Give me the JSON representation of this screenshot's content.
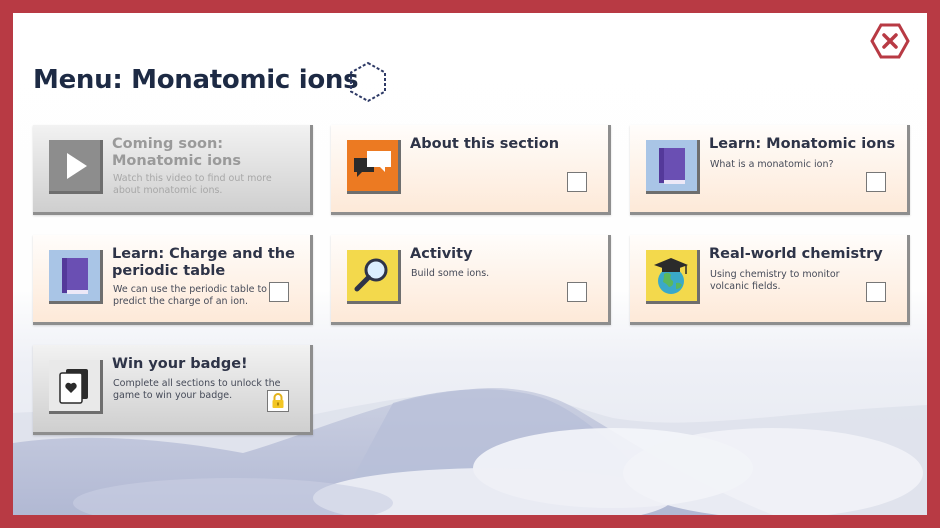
{
  "page": {
    "title": "Menu: Monatomic ions"
  },
  "colors": {
    "frame": "#b83a44",
    "title": "#1d2a44",
    "card_top": "#fffdfb",
    "card_bottom": "#fde9d8",
    "disabled": "#cfcfcf"
  },
  "cards": [
    {
      "title": "Coming soon: Monatomic ions",
      "desc": "Watch this video to find out more about monatomic ions.",
      "icon": "play-icon",
      "state": "disabled"
    },
    {
      "title": "About this section",
      "desc": "",
      "icon": "speech-bubbles-icon",
      "state": "unchecked"
    },
    {
      "title": "Learn: Monatomic ions",
      "desc": "What is a monatomic ion?",
      "icon": "book-icon",
      "state": "unchecked"
    },
    {
      "title": "Learn: Charge and the periodic table",
      "desc": "We can use the periodic table to predict the charge of an ion.",
      "icon": "book-icon",
      "state": "unchecked"
    },
    {
      "title": "Activity",
      "desc": "Build some ions.",
      "icon": "magnifier-icon",
      "state": "unchecked"
    },
    {
      "title": "Real-world chemistry",
      "desc": "Using chemistry to monitor volcanic fields.",
      "icon": "globe-graduation-cap-icon",
      "state": "unchecked"
    },
    {
      "title": "Win your badge!",
      "desc": "Complete all sections to unlock the game to win your badge.",
      "icon": "heart-card-icon",
      "state": "locked"
    }
  ]
}
